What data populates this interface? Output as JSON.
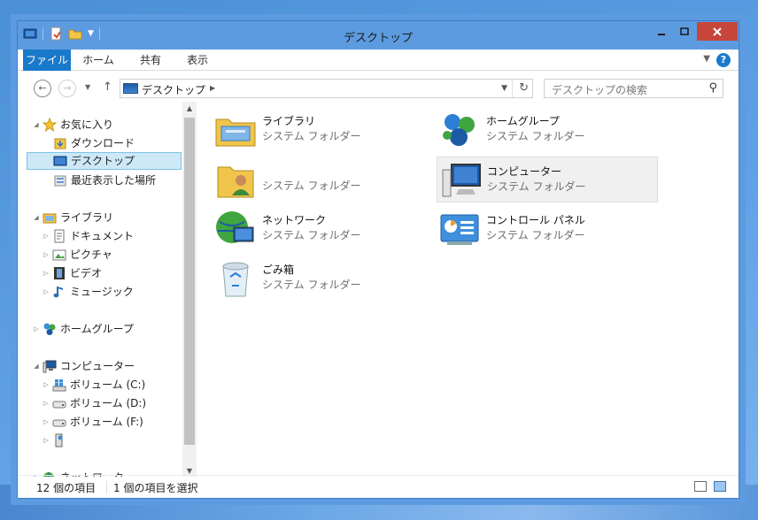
{
  "window": {
    "title": "デスクトップ"
  },
  "ribbon": {
    "tabs": [
      "ファイル",
      "ホーム",
      "共有",
      "表示"
    ],
    "help": "?"
  },
  "address": {
    "path": "デスクトップ",
    "search_placeholder": "デスクトップの検索"
  },
  "nav": {
    "favorites": "お気に入り",
    "downloads": "ダウンロード",
    "desktop": "デスクトップ",
    "recent": "最近表示した場所",
    "libraries": "ライブラリ",
    "documents": "ドキュメント",
    "pictures": "ピクチャ",
    "videos": "ビデオ",
    "music": "ミュージック",
    "homegroup": "ホームグループ",
    "computer": "コンピューター",
    "vol_c": "ボリューム (C:)",
    "vol_d": "ボリューム (D:)",
    "vol_f": "ボリューム (F:)",
    "network": "ネットワーク"
  },
  "items": [
    {
      "name": "ライブラリ",
      "type": "システム フォルダー"
    },
    {
      "name": "ホームグループ",
      "type": "システム フォルダー"
    },
    {
      "name": "",
      "type": "システム フォルダー"
    },
    {
      "name": "コンピューター",
      "type": "システム フォルダー"
    },
    {
      "name": "ネットワーク",
      "type": "システム フォルダー"
    },
    {
      "name": "コントロール パネル",
      "type": "システム フォルダー"
    },
    {
      "name": "ごみ箱",
      "type": "システム フォルダー"
    }
  ],
  "status": {
    "count": "12 個の項目",
    "selected": "1 個の項目を選択"
  },
  "colors": {
    "accent": "#1979ca",
    "frame": "#5d9be0",
    "selection": "#cde8f6",
    "close": "#c7463c"
  }
}
